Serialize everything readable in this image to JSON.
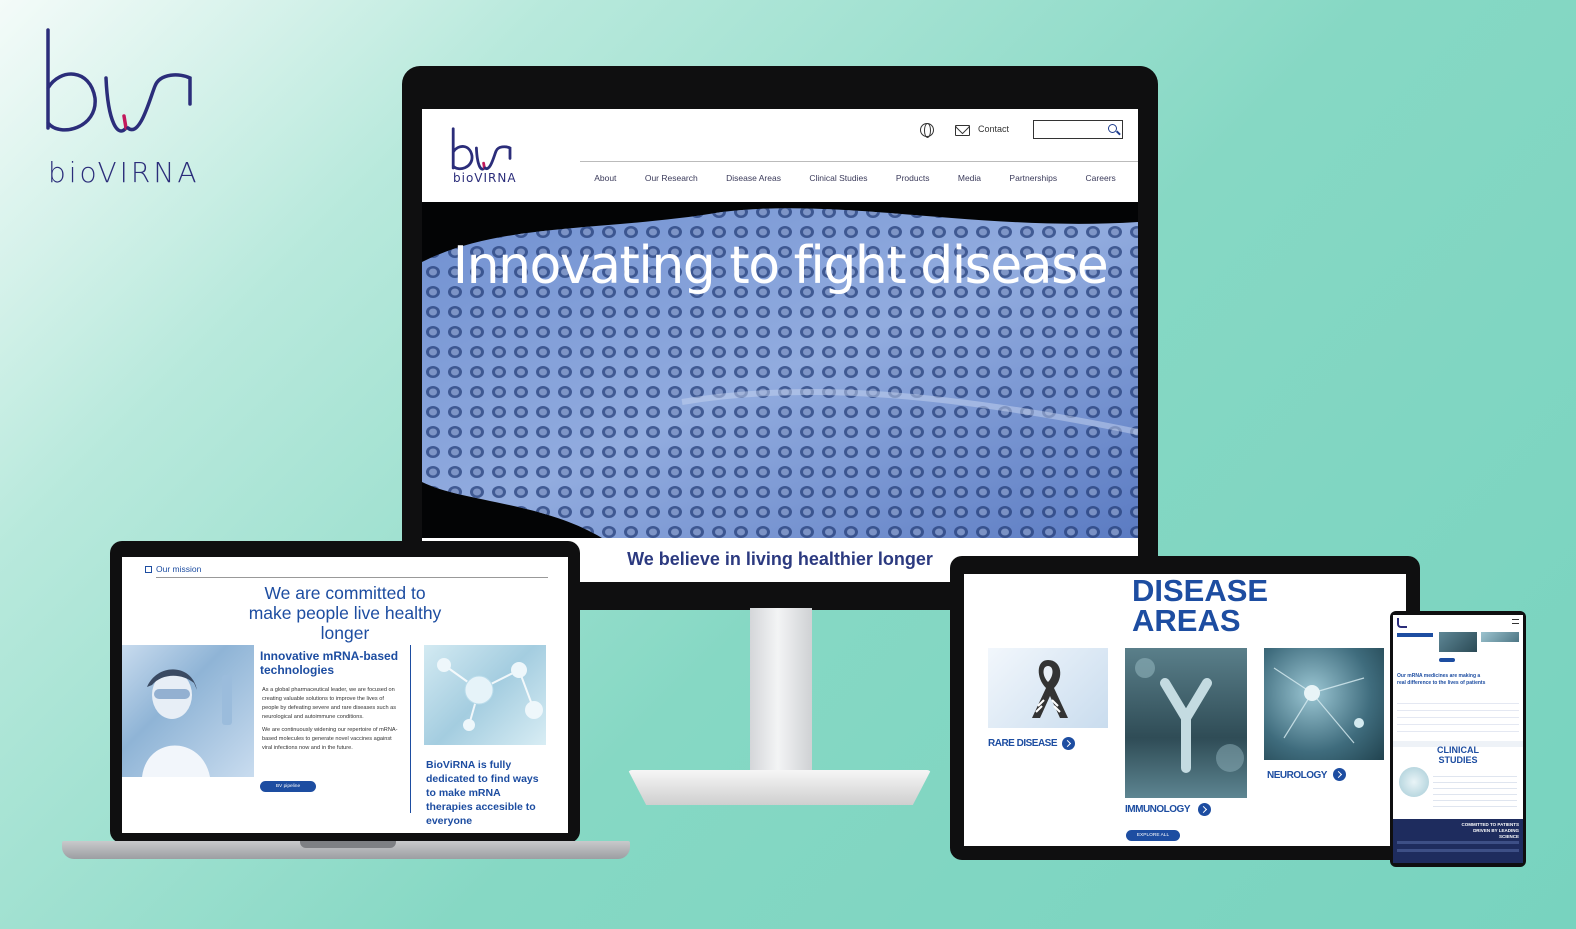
{
  "brand": {
    "name": "bioVIRNA"
  },
  "monitor": {
    "logo_text": "bioVIRNA",
    "header": {
      "contact_label": "Contact",
      "search_placeholder": ""
    },
    "nav": [
      "About",
      "Our Research",
      "Disease Areas",
      "Clinical Studies",
      "Products",
      "Media",
      "Partnerships",
      "Careers"
    ],
    "hero_title": "Innovating to fight disease",
    "tagline": "We believe in living healthier longer"
  },
  "laptop": {
    "section_label": "Our mission",
    "headline": "We are committed to make people live healthy longer",
    "feature_title": "Innovative mRNA-based technologies",
    "paragraph_1": "As a global pharmaceutical leader, we are focused on creating valuable solutions to improve the lives of people by defeating severe and rare diseases such as neurological and autoimmune conditions.",
    "paragraph_2": "We are continuously widening our repertoire of mRNA-based molecules to generate novel vaccines against viral infections now and in the future.",
    "button_label": "BV pipeline",
    "dedicated_text": "BioViRNA is fully dedicated to find ways to make mRNA therapies accesible to everyone"
  },
  "tablet": {
    "title_line1": "DISEASE",
    "title_line2": "AREAS",
    "areas": [
      {
        "label": "RARE DISEASE"
      },
      {
        "label": "IMMUNOLOGY"
      },
      {
        "label": "NEUROLOGY"
      }
    ],
    "explore_label": "EXPLORE ALL"
  },
  "phone": {
    "intro": "Our mRNA medicines are making a real difference to the lives of patients",
    "clinical_title": "CLINICAL STUDIES",
    "footer_text": "COMMITTED TO PATIENTS DRIVEN BY LEADING SCIENCE"
  },
  "colors": {
    "accent": "#1d4da1",
    "brand": "#2b2d7a",
    "logo_pink": "#c2185b",
    "background": "#86d8c4"
  }
}
